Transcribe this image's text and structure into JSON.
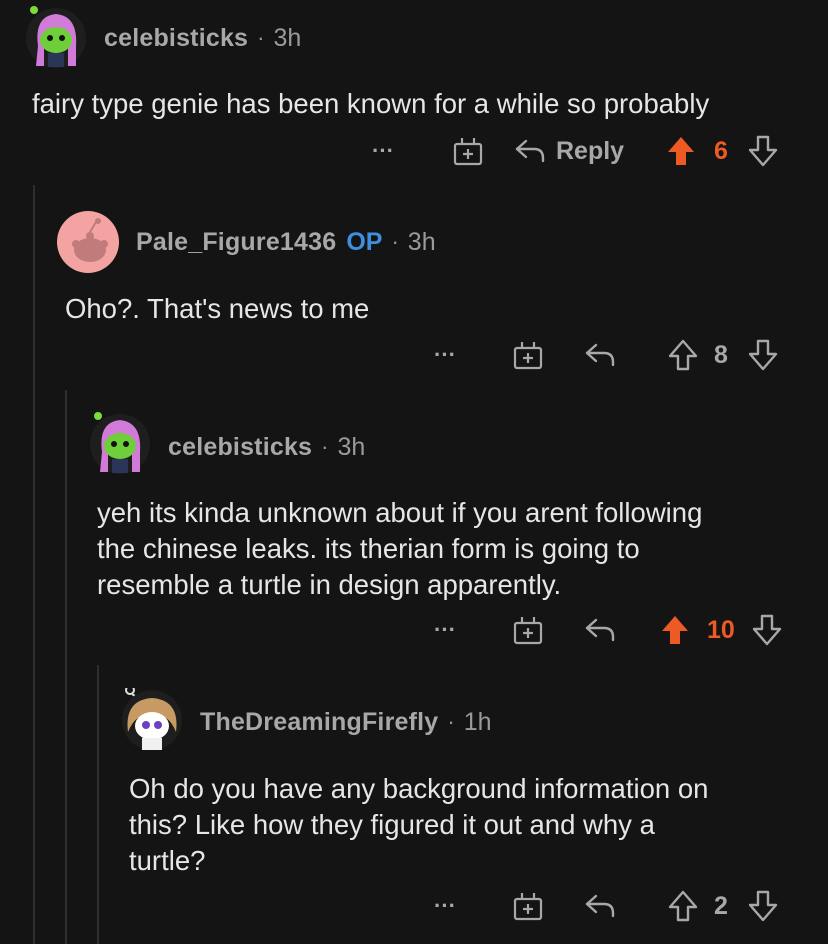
{
  "comments": [
    {
      "username": "celebisticks",
      "op": "",
      "separator": "·",
      "time": "3h",
      "text": "fairy type genie has been known for a while so probably",
      "actions": {
        "more": "···",
        "reply_label": "Reply",
        "score": "6",
        "upvoted": true
      },
      "avatar_icon": "snoo-avatar-pink-hair"
    },
    {
      "username": "Pale_Figure1436",
      "op": "OP",
      "separator": "·",
      "time": "3h",
      "text": "Oho?. That's news to me",
      "actions": {
        "more": "···",
        "reply_label": "",
        "score": "8",
        "upvoted": false
      },
      "avatar_icon": "default-snoo-avatar-pink"
    },
    {
      "username": "celebisticks",
      "op": "",
      "separator": "·",
      "time": "3h",
      "text": "yeh its kinda unknown about if you arent following\nthe chinese leaks. its therian form is going to\nresemble a turtle in design apparently.",
      "actions": {
        "more": "···",
        "reply_label": "",
        "score": "10",
        "upvoted": true
      },
      "avatar_icon": "snoo-avatar-pink-hair"
    },
    {
      "username": "TheDreamingFirefly",
      "op": "",
      "separator": "·",
      "time": "1h",
      "text": "Oh do you have any background information on\nthis? Like how they figured it out and why a\nturtle?",
      "actions": {
        "more": "···",
        "reply_label": "",
        "score": "2",
        "upvoted": false
      },
      "avatar_icon": "snoo-avatar-brown-hair"
    }
  ],
  "colors": {
    "background": "#141414",
    "upvote": "#ee5a24",
    "op_badge": "#3d8fe0",
    "muted": "#a8a8a8"
  }
}
